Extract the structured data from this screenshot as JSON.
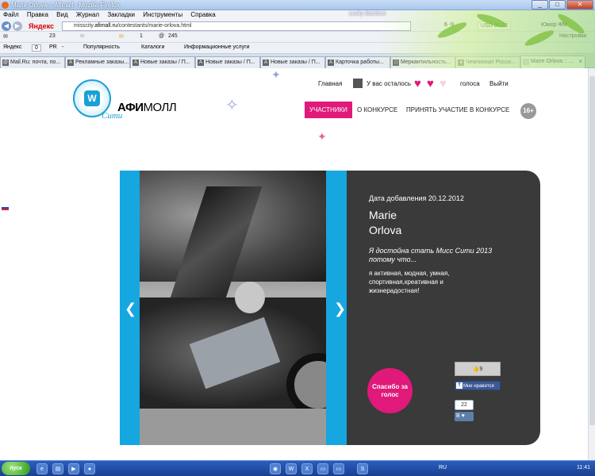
{
  "window": {
    "title": "Marie Orlova :: Afimall - Mozilla Firefox",
    "theme_text": "Lucky Bamboo",
    "controls": {
      "minimize": "_",
      "maximize": "□",
      "close": "✕"
    }
  },
  "menu": [
    "Файл",
    "Правка",
    "Вид",
    "Журнал",
    "Закладки",
    "Инструменты",
    "Справка"
  ],
  "navbar": {
    "yandex_label": "Яндекс",
    "url_prefix": "misscity.",
    "url_domain": "afimall.ru",
    "url_path": "/contestants/marie-orlova.html",
    "weather": "6  -9",
    "usd": "USD 30,72",
    "radio": "Юмор ФМ"
  },
  "toolbar": {
    "mail_count": "23",
    "pr_label": "PR",
    "pr_value": "-",
    "tic_label": "Яндекс",
    "tic_value": "0",
    "likes": "1",
    "points": "245",
    "settings": "Настройки"
  },
  "bookmarks": [
    "Популярность",
    "Каталоги",
    "Информационные услуги"
  ],
  "tabs": [
    {
      "label": "Mail.Ru: почта, по...",
      "active": false
    },
    {
      "label": "Рекламные заказы...",
      "active": false
    },
    {
      "label": "Новые заказы / П...",
      "active": false
    },
    {
      "label": "Новые заказы / П...",
      "active": false
    },
    {
      "label": "Новые заказы / П...",
      "active": false
    },
    {
      "label": "Карточка работы...",
      "active": false
    },
    {
      "label": "Меркантильность...",
      "active": false
    },
    {
      "label": "Чемпионат Росси...",
      "active": false
    },
    {
      "label": "Marie Orlova :: ...",
      "active": true
    }
  ],
  "site": {
    "logo": {
      "mark": "W",
      "brand_bold": "АФИ",
      "brand_rest": "МОЛЛ",
      "sub": "Сити"
    },
    "topnav": {
      "home": "Главная",
      "remaining": "У вас осталось",
      "votes": "голоса",
      "logout": "Выйти",
      "hearts_total": 3,
      "hearts_filled": 2
    },
    "mainnav": {
      "participants": "УЧАСТНИКИ",
      "about": "О КОНКУРСЕ",
      "join": "ПРИНЯТЬ УЧАСТИЕ В КОНКУРСЕ"
    },
    "age": "16+",
    "colors": {
      "accent": "#e0197a",
      "blue": "#16a6e0",
      "dark": "#3a3a3a"
    }
  },
  "profile": {
    "date": "Дата добавления 20.12.2012",
    "first_name": "Marie",
    "last_name": "Orlova",
    "quote": "Я достойна стать Мисс Сити 2013 потому что...",
    "about": "я активная, модная, умная, спортивная,креативная и жизнерадостная!",
    "vote_button": "Спасибо за голос",
    "like_count": "9",
    "like_button": "Мне нравится",
    "vk_count": "22",
    "vk_label": "В"
  },
  "taskbar": {
    "start": "пуск",
    "lang": "RU",
    "time": "11:41"
  }
}
